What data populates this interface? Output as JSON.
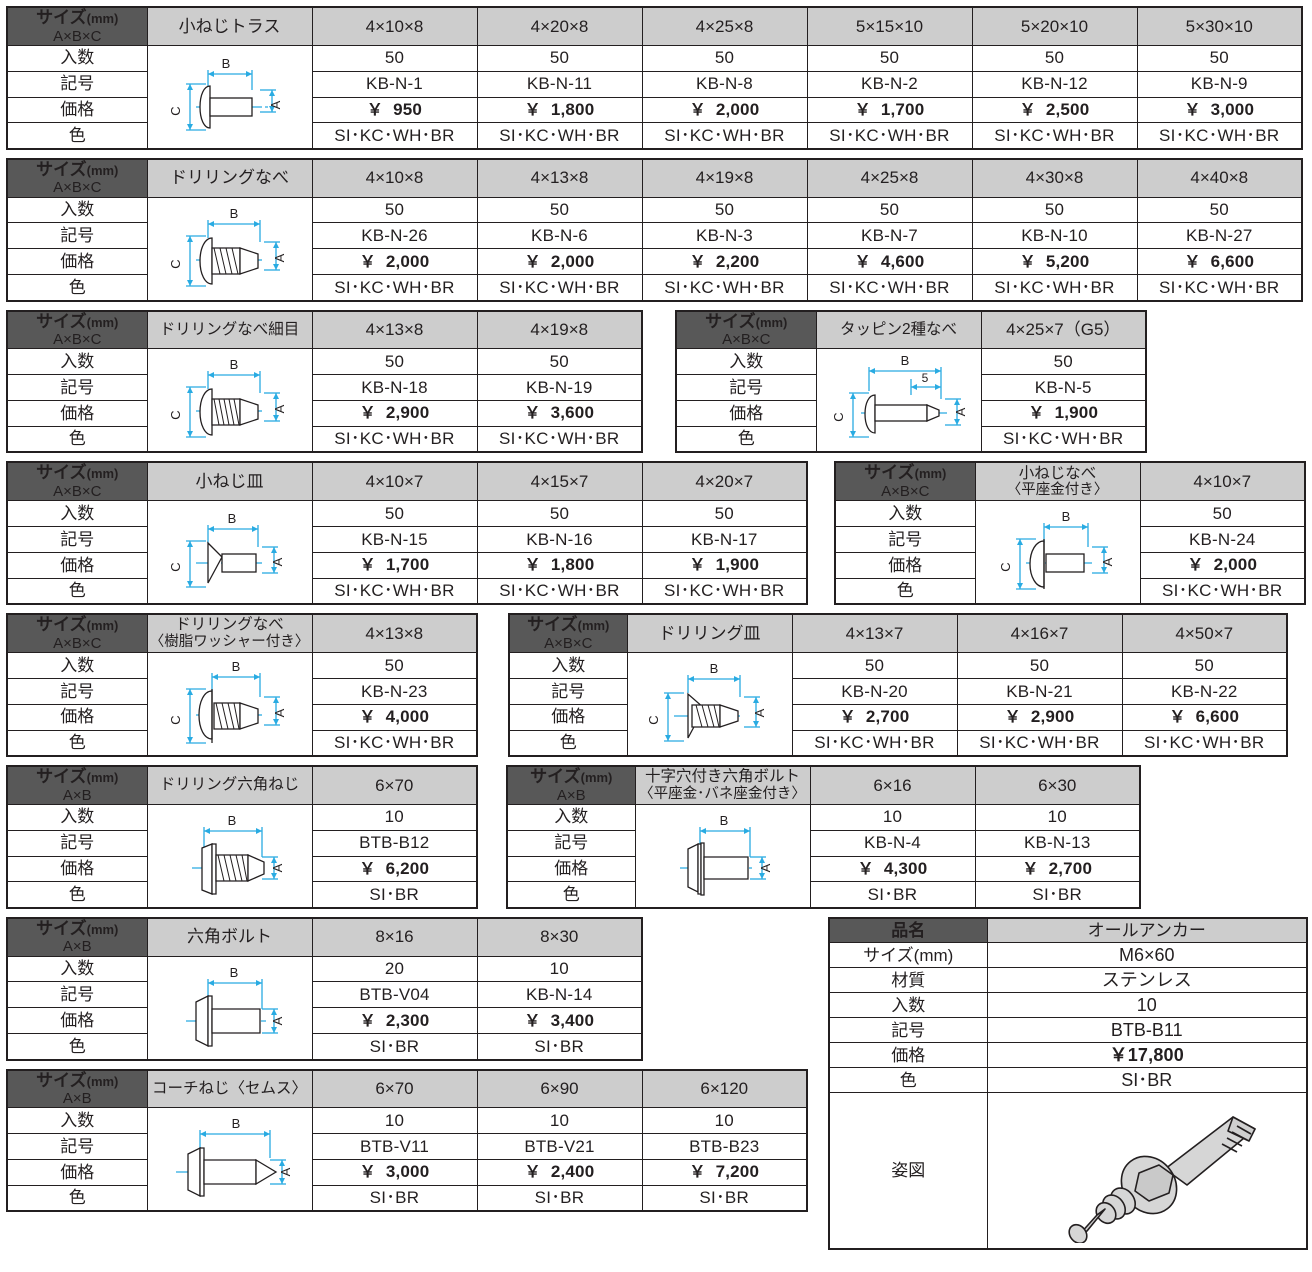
{
  "labels": {
    "size_mm_main": "サイズ",
    "size_mm_paren": "(mm)",
    "abc": "A×B×C",
    "ab": "A×B",
    "quantity": "入数",
    "symbol": "記号",
    "price": "価格",
    "color": "色",
    "yen": "￥",
    "product_name": "品名",
    "size_mm_label": "サイズ(mm)",
    "material": "材質",
    "figure": "姿図",
    "dim_a": "A",
    "dim_b": "B",
    "dim_c": "C",
    "dim_5": "5"
  },
  "colors": {
    "header_dark": "#585858",
    "header_gray": "#cdcdcd",
    "border": "#231f20",
    "dimension_blue": "#29abe2",
    "figure_fill": "#d6d6d6"
  },
  "blocks": [
    {
      "id": "kone ji torus",
      "product": "小ねじトラス",
      "size_key": "A×B×C",
      "figure": "truss-screw",
      "sizes": [
        "4×10×8",
        "4×20×8",
        "4×25×8",
        "5×15×10",
        "5×20×10",
        "5×30×10"
      ],
      "quantity": [
        "50",
        "50",
        "50",
        "50",
        "50",
        "50"
      ],
      "symbol": [
        "KB-N-1",
        "KB-N-11",
        "KB-N-8",
        "KB-N-2",
        "KB-N-12",
        "KB-N-9"
      ],
      "price": [
        "950",
        "1,800",
        "2,000",
        "1,700",
        "2,500",
        "3,000"
      ],
      "color": [
        "SI･KC･WH･BR",
        "SI･KC･WH･BR",
        "SI･KC･WH･BR",
        "SI･KC･WH･BR",
        "SI･KC･WH･BR",
        "SI･KC･WH･BR"
      ]
    },
    {
      "id": "drilling-nabe",
      "product": "ドリリングなべ",
      "size_key": "A×B×C",
      "figure": "drilling-pan",
      "sizes": [
        "4×10×8",
        "4×13×8",
        "4×19×8",
        "4×25×8",
        "4×30×8",
        "4×40×8"
      ],
      "quantity": [
        "50",
        "50",
        "50",
        "50",
        "50",
        "50"
      ],
      "symbol": [
        "KB-N-26",
        "KB-N-6",
        "KB-N-3",
        "KB-N-7",
        "KB-N-10",
        "KB-N-27"
      ],
      "price": [
        "2,000",
        "2,000",
        "2,200",
        "4,600",
        "5,200",
        "6,600"
      ],
      "color": [
        "SI･KC･WH･BR",
        "SI･KC･WH･BR",
        "SI･KC･WH･BR",
        "SI･KC･WH･BR",
        "SI･KC･WH･BR",
        "SI･KC･WH･BR"
      ]
    },
    {
      "id": "drilling-nabe-hosome",
      "product": "ドリリングなべ細目",
      "size_key": "A×B×C",
      "figure": "drilling-pan",
      "sizes": [
        "4×13×8",
        "4×19×8"
      ],
      "quantity": [
        "50",
        "50"
      ],
      "symbol": [
        "KB-N-18",
        "KB-N-19"
      ],
      "price": [
        "2,900",
        "3,600"
      ],
      "color": [
        "SI･KC･WH･BR",
        "SI･KC･WH･BR"
      ]
    },
    {
      "id": "tapping-2shu-nabe",
      "product": "タッピン2種なべ",
      "size_key": "A×B×C",
      "figure": "tapping-pan",
      "sizes": [
        "4×25×7（G5）"
      ],
      "quantity": [
        "50"
      ],
      "symbol": [
        "KB-N-5"
      ],
      "price": [
        "1,900"
      ],
      "color": [
        "SI･KC･WH･BR"
      ]
    },
    {
      "id": "kone ji sara",
      "product": "小ねじ皿",
      "size_key": "A×B×C",
      "figure": "flat-screw",
      "sizes": [
        "4×10×7",
        "4×15×7",
        "4×20×7"
      ],
      "quantity": [
        "50",
        "50",
        "50"
      ],
      "symbol": [
        "KB-N-15",
        "KB-N-16",
        "KB-N-17"
      ],
      "price": [
        "1,700",
        "1,800",
        "1,900"
      ],
      "color": [
        "SI･KC･WH･BR",
        "SI･KC･WH･BR",
        "SI･KC･WH･BR"
      ]
    },
    {
      "id": "kone ji nabe washer",
      "product_line1": "小ねじなべ",
      "product_line2": "〈平座金付き〉",
      "size_key": "A×B×C",
      "figure": "pan-washer",
      "sizes": [
        "4×10×7"
      ],
      "quantity": [
        "50"
      ],
      "symbol": [
        "KB-N-24"
      ],
      "price": [
        "2,000"
      ],
      "color": [
        "SI･KC･WH･BR"
      ]
    },
    {
      "id": "drilling-nabe-resin-washer",
      "product_line1": "ドリリングなべ",
      "product_line2": "〈樹脂ワッシャー付き〉",
      "size_key": "A×B×C",
      "figure": "drilling-pan-washer",
      "sizes": [
        "4×13×8"
      ],
      "quantity": [
        "50"
      ],
      "symbol": [
        "KB-N-23"
      ],
      "price": [
        "4,000"
      ],
      "color": [
        "SI･KC･WH･BR"
      ]
    },
    {
      "id": "drilling-sara",
      "product": "ドリリング皿",
      "size_key": "A×B×C",
      "figure": "drilling-flat",
      "sizes": [
        "4×13×7",
        "4×16×7",
        "4×50×7"
      ],
      "quantity": [
        "50",
        "50",
        "50"
      ],
      "symbol": [
        "KB-N-20",
        "KB-N-21",
        "KB-N-22"
      ],
      "price": [
        "2,700",
        "2,900",
        "6,600"
      ],
      "color": [
        "SI･KC･WH･BR",
        "SI･KC･WH･BR",
        "SI･KC･WH･BR"
      ]
    },
    {
      "id": "drilling-hex",
      "product": "ドリリング六角ねじ",
      "size_key": "A×B",
      "figure": "drilling-hex",
      "sizes": [
        "6×70"
      ],
      "quantity": [
        "10"
      ],
      "symbol": [
        "BTB-B12"
      ],
      "price": [
        "6,200"
      ],
      "color": [
        "SI･BR"
      ]
    },
    {
      "id": "cross-hex-bolt",
      "product_line1": "十字穴付き六角ボルト",
      "product_line2": "〈平座金･バネ座金付き〉",
      "size_key": "A×B",
      "figure": "hex-bolt-washer",
      "sizes": [
        "6×16",
        "6×30"
      ],
      "quantity": [
        "10",
        "10"
      ],
      "symbol": [
        "KB-N-4",
        "KB-N-13"
      ],
      "price": [
        "4,300",
        "2,700"
      ],
      "color": [
        "SI･BR",
        "SI･BR"
      ]
    },
    {
      "id": "hex-bolt",
      "product": "六角ボルト",
      "size_key": "A×B",
      "figure": "hex-bolt",
      "sizes": [
        "8×16",
        "8×30"
      ],
      "quantity": [
        "20",
        "10"
      ],
      "symbol": [
        "BTB-V04",
        "KB-N-14"
      ],
      "price": [
        "2,300",
        "3,400"
      ],
      "color": [
        "SI･BR",
        "SI･BR"
      ]
    },
    {
      "id": "coach-screw",
      "product": "コーチねじ〈セムス〉",
      "size_key": "A×B",
      "figure": "coach-screw",
      "sizes": [
        "6×70",
        "6×90",
        "6×120"
      ],
      "quantity": [
        "10",
        "10",
        "10"
      ],
      "symbol": [
        "BTB-V11",
        "BTB-V21",
        "BTB-B23"
      ],
      "price": [
        "3,000",
        "2,400",
        "7,200"
      ],
      "color": [
        "SI･BR",
        "SI･BR",
        "SI･BR"
      ]
    }
  ],
  "anchor": {
    "header_label": "品名",
    "header_value": "オールアンカー",
    "rows": [
      {
        "label": "サイズ(mm)",
        "value": "M6×60"
      },
      {
        "label": "材質",
        "value": "ステンレス"
      },
      {
        "label": "入数",
        "value": "10"
      },
      {
        "label": "記号",
        "value": "BTB-B11"
      },
      {
        "label": "記号_price_label",
        "value": ""
      }
    ],
    "symbol_label": "記号",
    "symbol_value": "BTB-B11",
    "price_label": "価格",
    "price_value": "￥17,800",
    "color_label": "色",
    "color_value": "SI･BR",
    "figure_label": "姿図",
    "figure": "all-anchor"
  }
}
